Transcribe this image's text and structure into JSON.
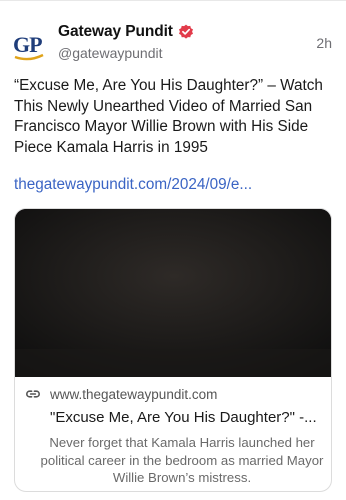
{
  "post": {
    "author": {
      "name": "Gateway Pundit",
      "handle": "@gatewaypundit",
      "avatar_text": "GP",
      "avatar_color": "#1f3d7a",
      "avatar_accent": "#e0a31a",
      "verified_icon": "verified-badge-icon",
      "verified_color": "#e23b4a"
    },
    "time": "2h",
    "text": "“Excuse Me, Are You His Daughter?” – Watch This Newly Unearthed Video of Married San Francisco Mayor Willie Brown with His Side Piece Kamala Harris in 1995",
    "link_text": "thegatewaypundit.com/2024/09/e...",
    "link_color": "#3a64c4",
    "card": {
      "image_icon": "video-thumbnail-image",
      "domain_icon": "link-icon",
      "domain": "www.thegatewaypundit.com",
      "title": "\"Excuse Me, Are You His Daughter?\" -...",
      "description": "Never forget that Kamala Harris launched her political career in the bedroom as married Mayor Willie Brown’s mistress."
    }
  }
}
